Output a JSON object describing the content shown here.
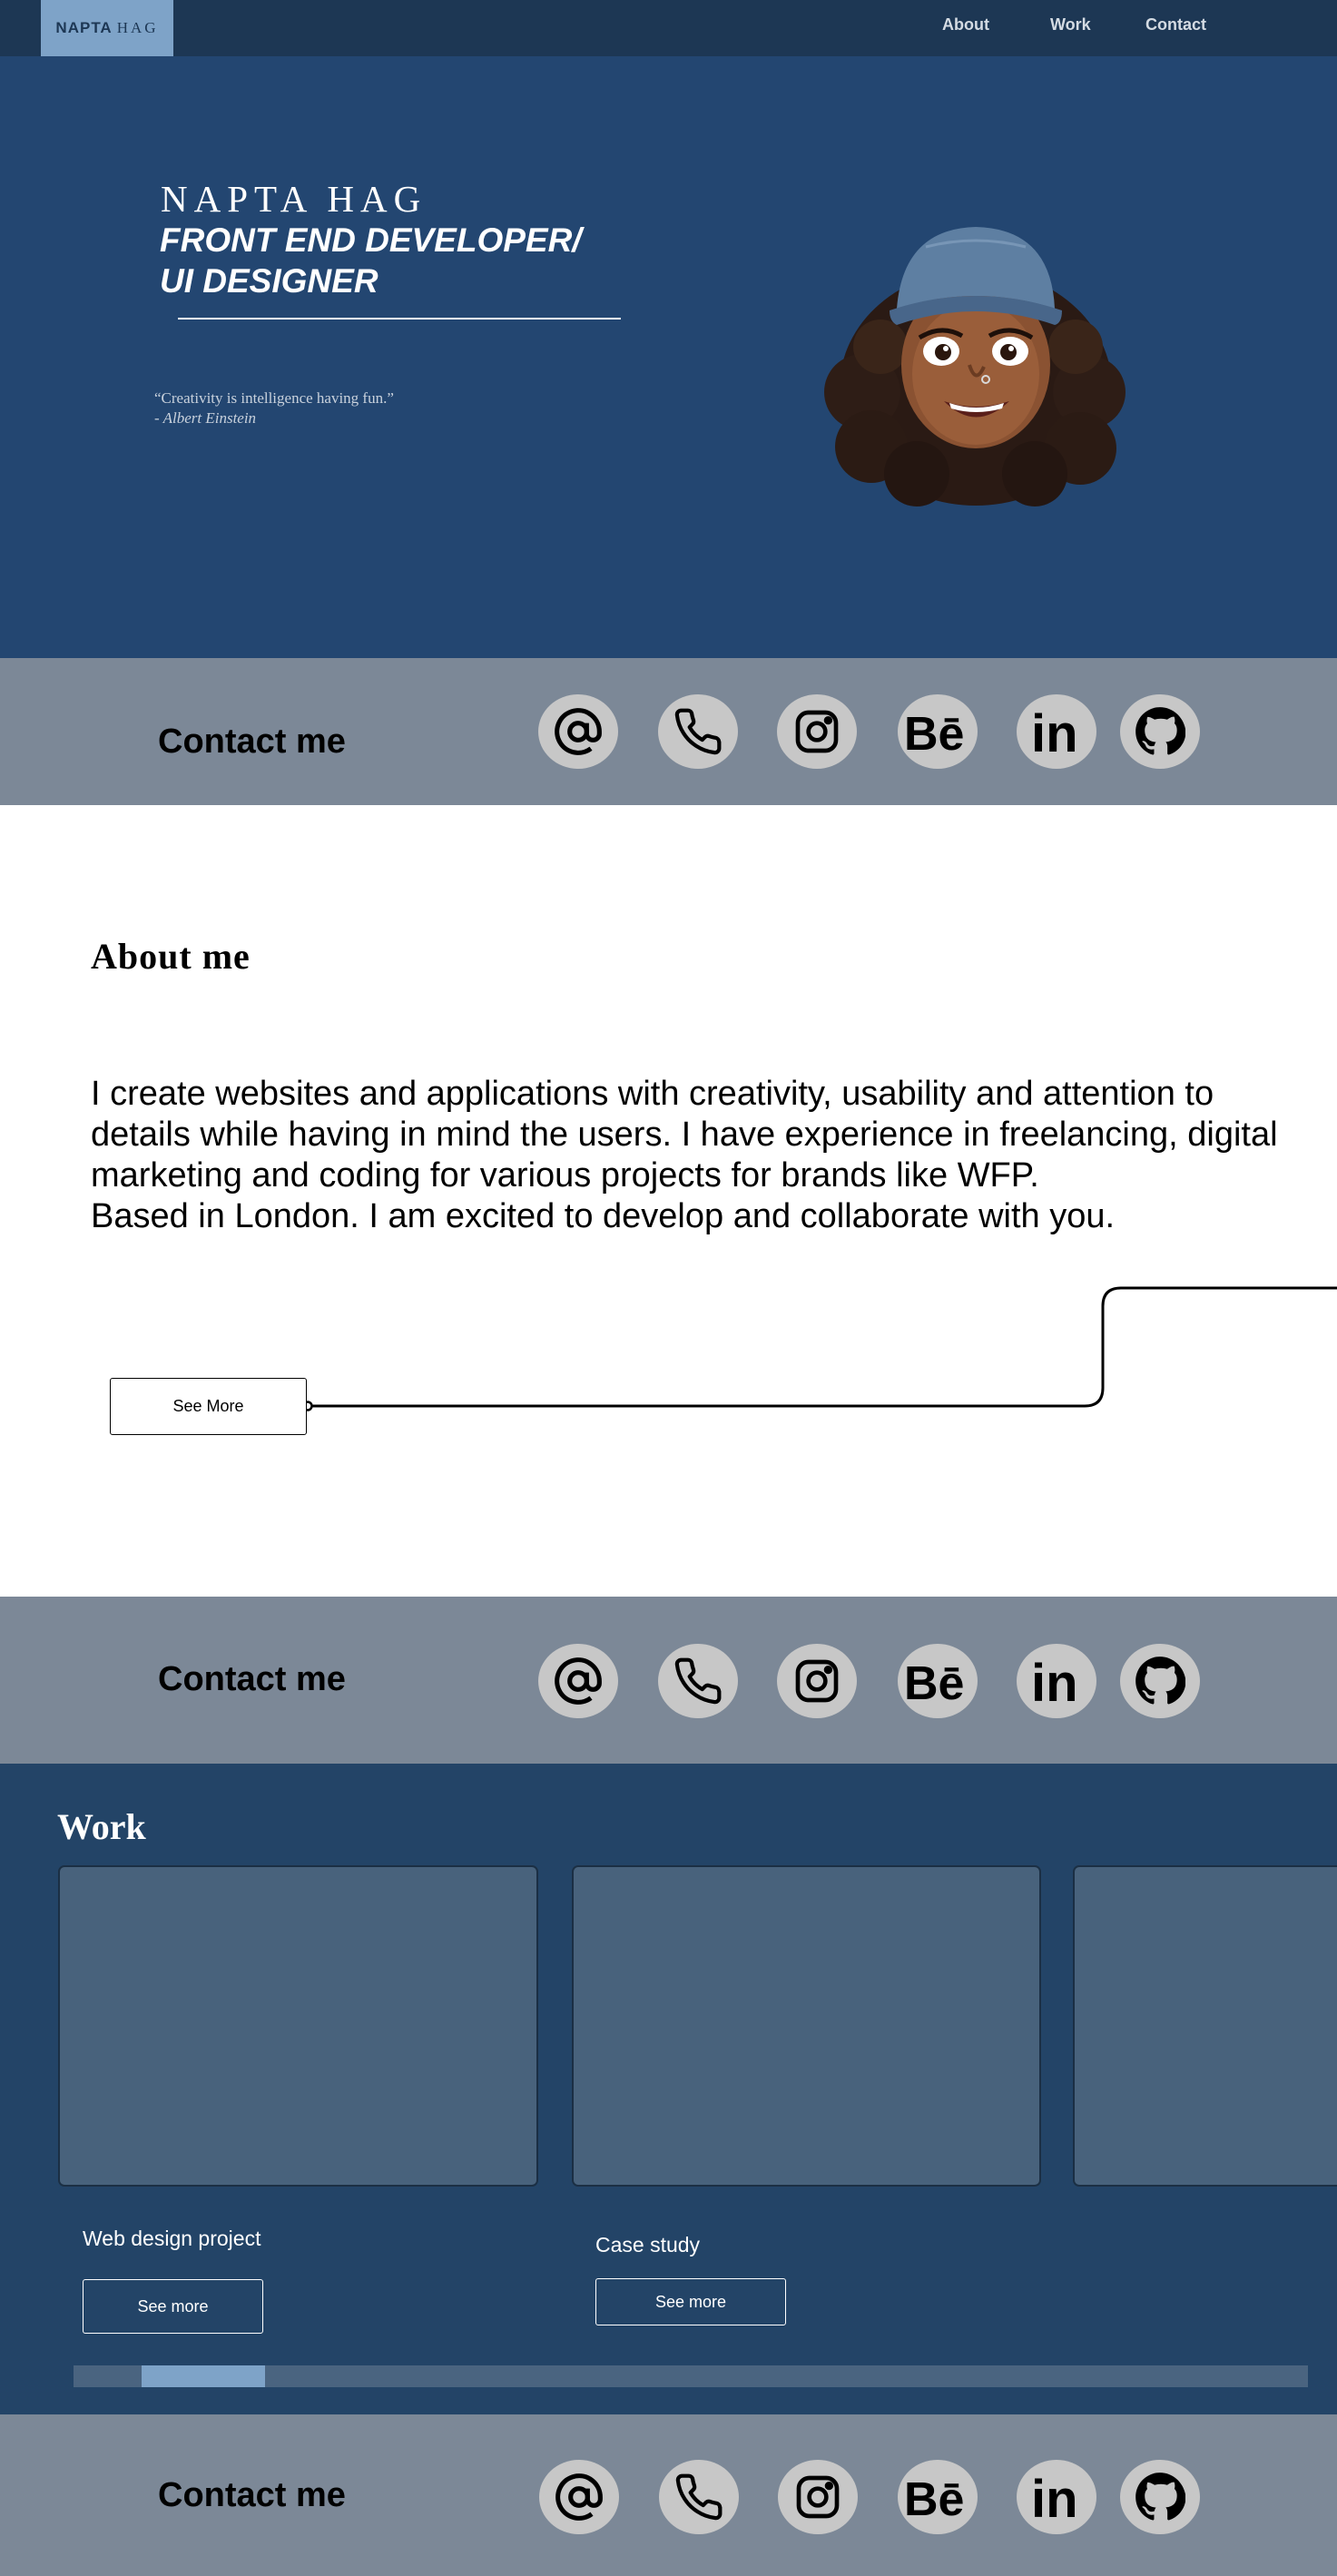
{
  "nav": {
    "logo_bold": "NAPTA",
    "logo_light": "HAG",
    "links": [
      "About",
      "Work",
      "Contact"
    ]
  },
  "hero": {
    "name": "NAPTA HAG",
    "role_line1": "FRONT END DEVELOPER/",
    "role_line2": "UI DESIGNER",
    "quote": "“Creativity is intelligence having fun.”",
    "quote_author": "- Albert Einstein"
  },
  "contact": {
    "title": "Contact me",
    "icons": [
      "at-sign-icon",
      "phone-icon",
      "instagram-icon",
      "behance-icon",
      "linkedin-icon",
      "github-icon"
    ]
  },
  "about": {
    "title": "About me",
    "lines": [
      "I create websites and applications with creativity, usability and attention to",
      "details while having in mind the users. I have experience in freelancing, digital",
      "marketing and coding for various projects for brands like WFP.",
      "Based in London. I am excited to develop and collaborate with you."
    ],
    "button": "See More"
  },
  "work": {
    "title": "Work",
    "projects": [
      {
        "title": "Web design project",
        "button": "See more"
      },
      {
        "title": "Case study",
        "button": "See more"
      }
    ],
    "scroll_position": 0.03,
    "scroll_visible_fraction": 0.1
  },
  "colors": {
    "nav_bg": "#1d3754",
    "hero_bg": "#234671",
    "accent": "#7ea3c8",
    "contact_bg": "#7c8897",
    "work_bg": "#234467",
    "card_bg": "#48627c"
  }
}
